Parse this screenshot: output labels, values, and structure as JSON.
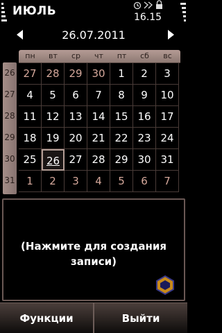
{
  "status": {
    "app_title": "ИЮЛЬ",
    "time": "16.15"
  },
  "header": {
    "date": "26.07.2011"
  },
  "calendar": {
    "weekdays": [
      "пн",
      "вт",
      "ср",
      "чт",
      "пт",
      "сб",
      "вс"
    ],
    "weeks": [
      {
        "num": "26",
        "days": [
          {
            "d": "27",
            "other": true
          },
          {
            "d": "28",
            "other": true
          },
          {
            "d": "29",
            "other": true
          },
          {
            "d": "30",
            "other": true
          },
          {
            "d": "1"
          },
          {
            "d": "2"
          },
          {
            "d": "3"
          }
        ]
      },
      {
        "num": "27",
        "days": [
          {
            "d": "4"
          },
          {
            "d": "5"
          },
          {
            "d": "6"
          },
          {
            "d": "7"
          },
          {
            "d": "8"
          },
          {
            "d": "9"
          },
          {
            "d": "10"
          }
        ]
      },
      {
        "num": "28",
        "days": [
          {
            "d": "11"
          },
          {
            "d": "12"
          },
          {
            "d": "13"
          },
          {
            "d": "14"
          },
          {
            "d": "15"
          },
          {
            "d": "16"
          },
          {
            "d": "17"
          }
        ]
      },
      {
        "num": "29",
        "days": [
          {
            "d": "18"
          },
          {
            "d": "19"
          },
          {
            "d": "20"
          },
          {
            "d": "21"
          },
          {
            "d": "22"
          },
          {
            "d": "23"
          },
          {
            "d": "24"
          }
        ]
      },
      {
        "num": "30",
        "days": [
          {
            "d": "25"
          },
          {
            "d": "26",
            "selected": true
          },
          {
            "d": "27"
          },
          {
            "d": "28"
          },
          {
            "d": "29"
          },
          {
            "d": "30"
          },
          {
            "d": "31"
          }
        ]
      },
      {
        "num": "31",
        "days": [
          {
            "d": "1",
            "other": true
          },
          {
            "d": "2",
            "other": true
          },
          {
            "d": "3",
            "other": true
          },
          {
            "d": "4",
            "other": true
          },
          {
            "d": "5",
            "other": true
          },
          {
            "d": "6",
            "other": true
          },
          {
            "d": "7",
            "other": true
          }
        ]
      }
    ]
  },
  "note": {
    "text": "(Нажмите для создания записи)"
  },
  "softkeys": {
    "left": "Функции",
    "right": "Выйти"
  },
  "colors": {
    "accent": "#b49b95",
    "other_month": "#d5a89b"
  }
}
